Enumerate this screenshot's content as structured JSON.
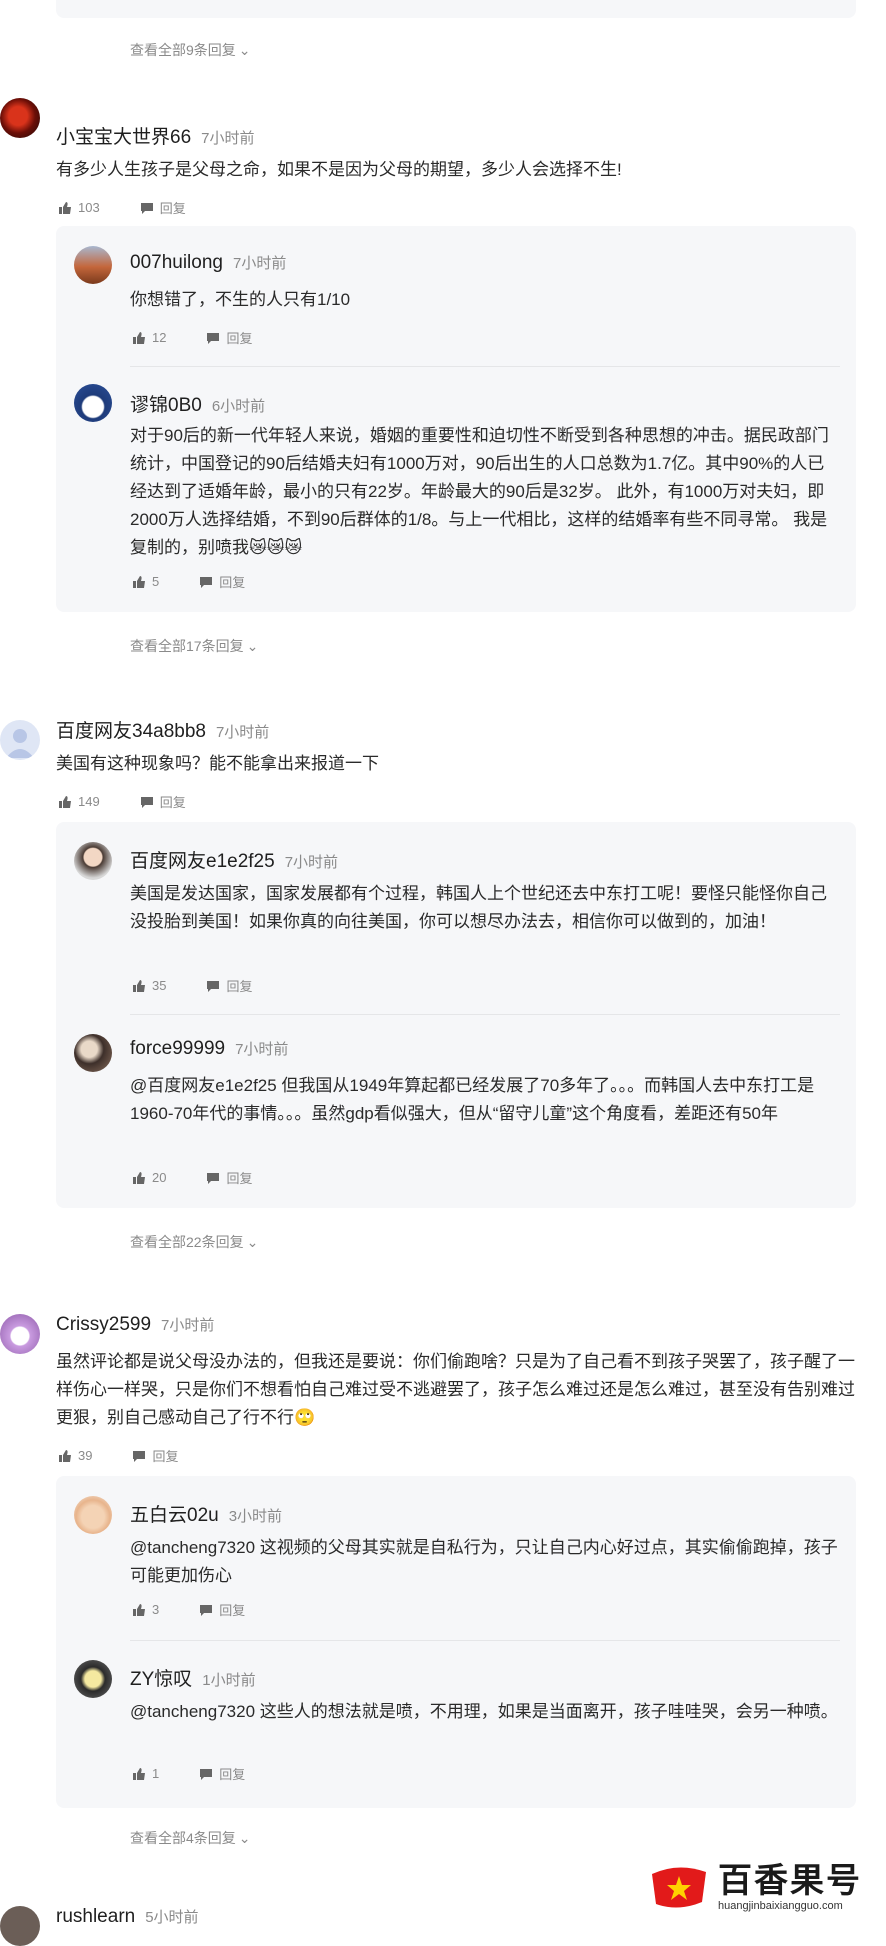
{
  "top_thread": {
    "view_more": "查看全部9条回复"
  },
  "threads": [
    {
      "author": "小宝宝大世界66",
      "time": "7小时前",
      "text": "有多少人生孩子是父母之命，如果不是因为父母的期望，多少人会选择不生!",
      "likes": "103",
      "reply_label": "回复",
      "replies": [
        {
          "author": "007huilong",
          "time": "7小时前",
          "text": "你想错了，不生的人只有1/10",
          "likes": "12",
          "reply_label": "回复"
        },
        {
          "author": "谬锦0B0",
          "time": "6小时前",
          "text": "对于90后的新一代年轻人来说，婚姻的重要性和迫切性不断受到各种思想的冲击。据民政部门统计，中国登记的90后结婚夫妇有1000万对，90后出生的人口总数为1.7亿。其中90%的人已经达到了适婚年龄，最小的只有22岁。年龄最大的90后是32岁。 此外，有1000万对夫妇，即2000万人选择结婚，不到90后群体的1/8。与上一代相比，这样的结婚率有些不同寻常。 我是复制的，别喷我😿😿😿",
          "likes": "5",
          "reply_label": "回复"
        }
      ],
      "view_more": "查看全部17条回复"
    },
    {
      "author": "百度网友34a8bb8",
      "time": "7小时前",
      "text": "美国有这种现象吗？能不能拿出来报道一下",
      "likes": "149",
      "reply_label": "回复",
      "replies": [
        {
          "author": "百度网友e1e2f25",
          "time": "7小时前",
          "text": "美国是发达国家，国家发展都有个过程，韩国人上个世纪还去中东打工呢！要怪只能怪你自己没投胎到美国！如果你真的向往美国，你可以想尽办法去，相信你可以做到的，加油！",
          "likes": "35",
          "reply_label": "回复"
        },
        {
          "author": "force99999",
          "time": "7小时前",
          "text": "@百度网友e1e2f25 但我国从1949年算起都已经发展了70多年了。。。而韩国人去中东打工是1960-70年代的事情。。。虽然gdp看似强大，但从“留守儿童”这个角度看，差距还有50年",
          "likes": "20",
          "reply_label": "回复"
        }
      ],
      "view_more": "查看全部22条回复"
    },
    {
      "author": "Crissy2599",
      "time": "7小时前",
      "text": "虽然评论都是说父母没办法的，但我还是要说：你们偷跑啥？只是为了自己看不到孩子哭罢了，孩子醒了一样伤心一样哭，只是你们不想看怕自己难过受不逃避罢了，孩子怎么难过还是怎么难过，甚至没有告别难过更狠，别自己感动自己了行不行🙄",
      "likes": "39",
      "reply_label": "回复",
      "replies": [
        {
          "author": "五白云02u",
          "time": "3小时前",
          "text": "@tancheng7320 这视频的父母其实就是自私行为，只让自己内心好过点，其实偷偷跑掉，孩子可能更加伤心",
          "likes": "3",
          "reply_label": "回复"
        },
        {
          "author": "ZY惊叹",
          "time": "1小时前",
          "text": "@tancheng7320 这些人的想法就是喷，不用理，如果是当面离开，孩子哇哇哭，会另一种喷。",
          "likes": "1",
          "reply_label": "回复"
        }
      ],
      "view_more": "查看全部4条回复"
    }
  ],
  "partial_next": {
    "author": "rushlearn",
    "time": "5小时前"
  },
  "watermark": {
    "brand": "百香果号",
    "url": "huangjinbaixiangguo.com"
  }
}
